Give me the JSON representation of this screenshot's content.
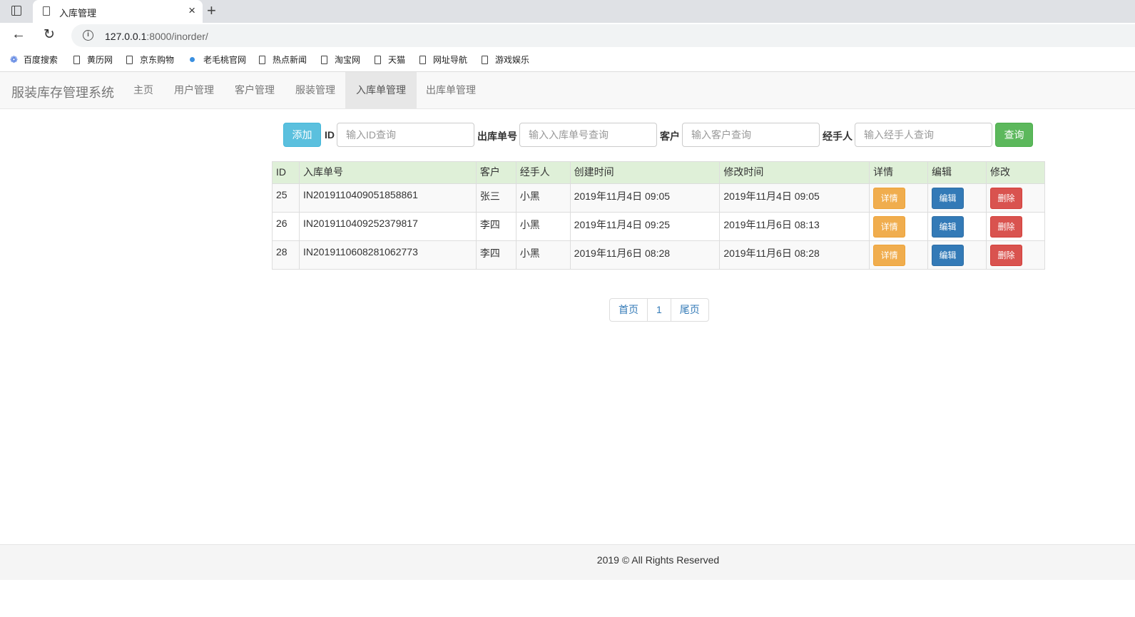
{
  "browser": {
    "tab_title": "入库管理",
    "tab_close": "×",
    "new_tab": "+",
    "url_host": "127.0.0.1",
    "url_path": ":8000/inorder/",
    "bookmarks": [
      "百度搜索",
      "黄历网",
      "京东购物",
      "老毛桃官网",
      "热点新闻",
      "淘宝网",
      "天猫",
      "网址导航",
      "游戏娱乐"
    ]
  },
  "navbar": {
    "brand": "服装库存管理系统",
    "items": [
      "主页",
      "用户管理",
      "客户管理",
      "服装管理",
      "入库单管理",
      "出库单管理"
    ],
    "active": "入库单管理"
  },
  "search": {
    "add_label": "添加",
    "id_label": "ID",
    "id_placeholder": "输入ID查询",
    "order_label": "出库单号",
    "order_placeholder": "输入入库单号查询",
    "customer_label": "客户",
    "customer_placeholder": "输入客户查询",
    "handler_label": "经手人",
    "handler_placeholder": "输入经手人查询",
    "query_label": "查询"
  },
  "table": {
    "headers": [
      "ID",
      "入库单号",
      "客户",
      "经手人",
      "创建时间",
      "修改时间",
      "详情",
      "编辑",
      "修改"
    ],
    "rows": [
      {
        "id": "25",
        "order": "IN2019110409051858861",
        "customer": "张三",
        "handler": "小黑",
        "created": "2019年11月4日 09:05",
        "modified": "2019年11月4日 09:05"
      },
      {
        "id": "26",
        "order": "IN2019110409252379817",
        "customer": "李四",
        "handler": "小黑",
        "created": "2019年11月4日 09:25",
        "modified": "2019年11月6日 08:13"
      },
      {
        "id": "28",
        "order": "IN2019110608281062773",
        "customer": "李四",
        "handler": "小黑",
        "created": "2019年11月6日 08:28",
        "modified": "2019年11月6日 08:28"
      }
    ],
    "detail_label": "详情",
    "edit_label": "编辑",
    "delete_label": "删除"
  },
  "pagination": {
    "first": "首页",
    "current": "1",
    "last": "尾页"
  },
  "footer": {
    "text": "2019 © All Rights Reserved"
  }
}
